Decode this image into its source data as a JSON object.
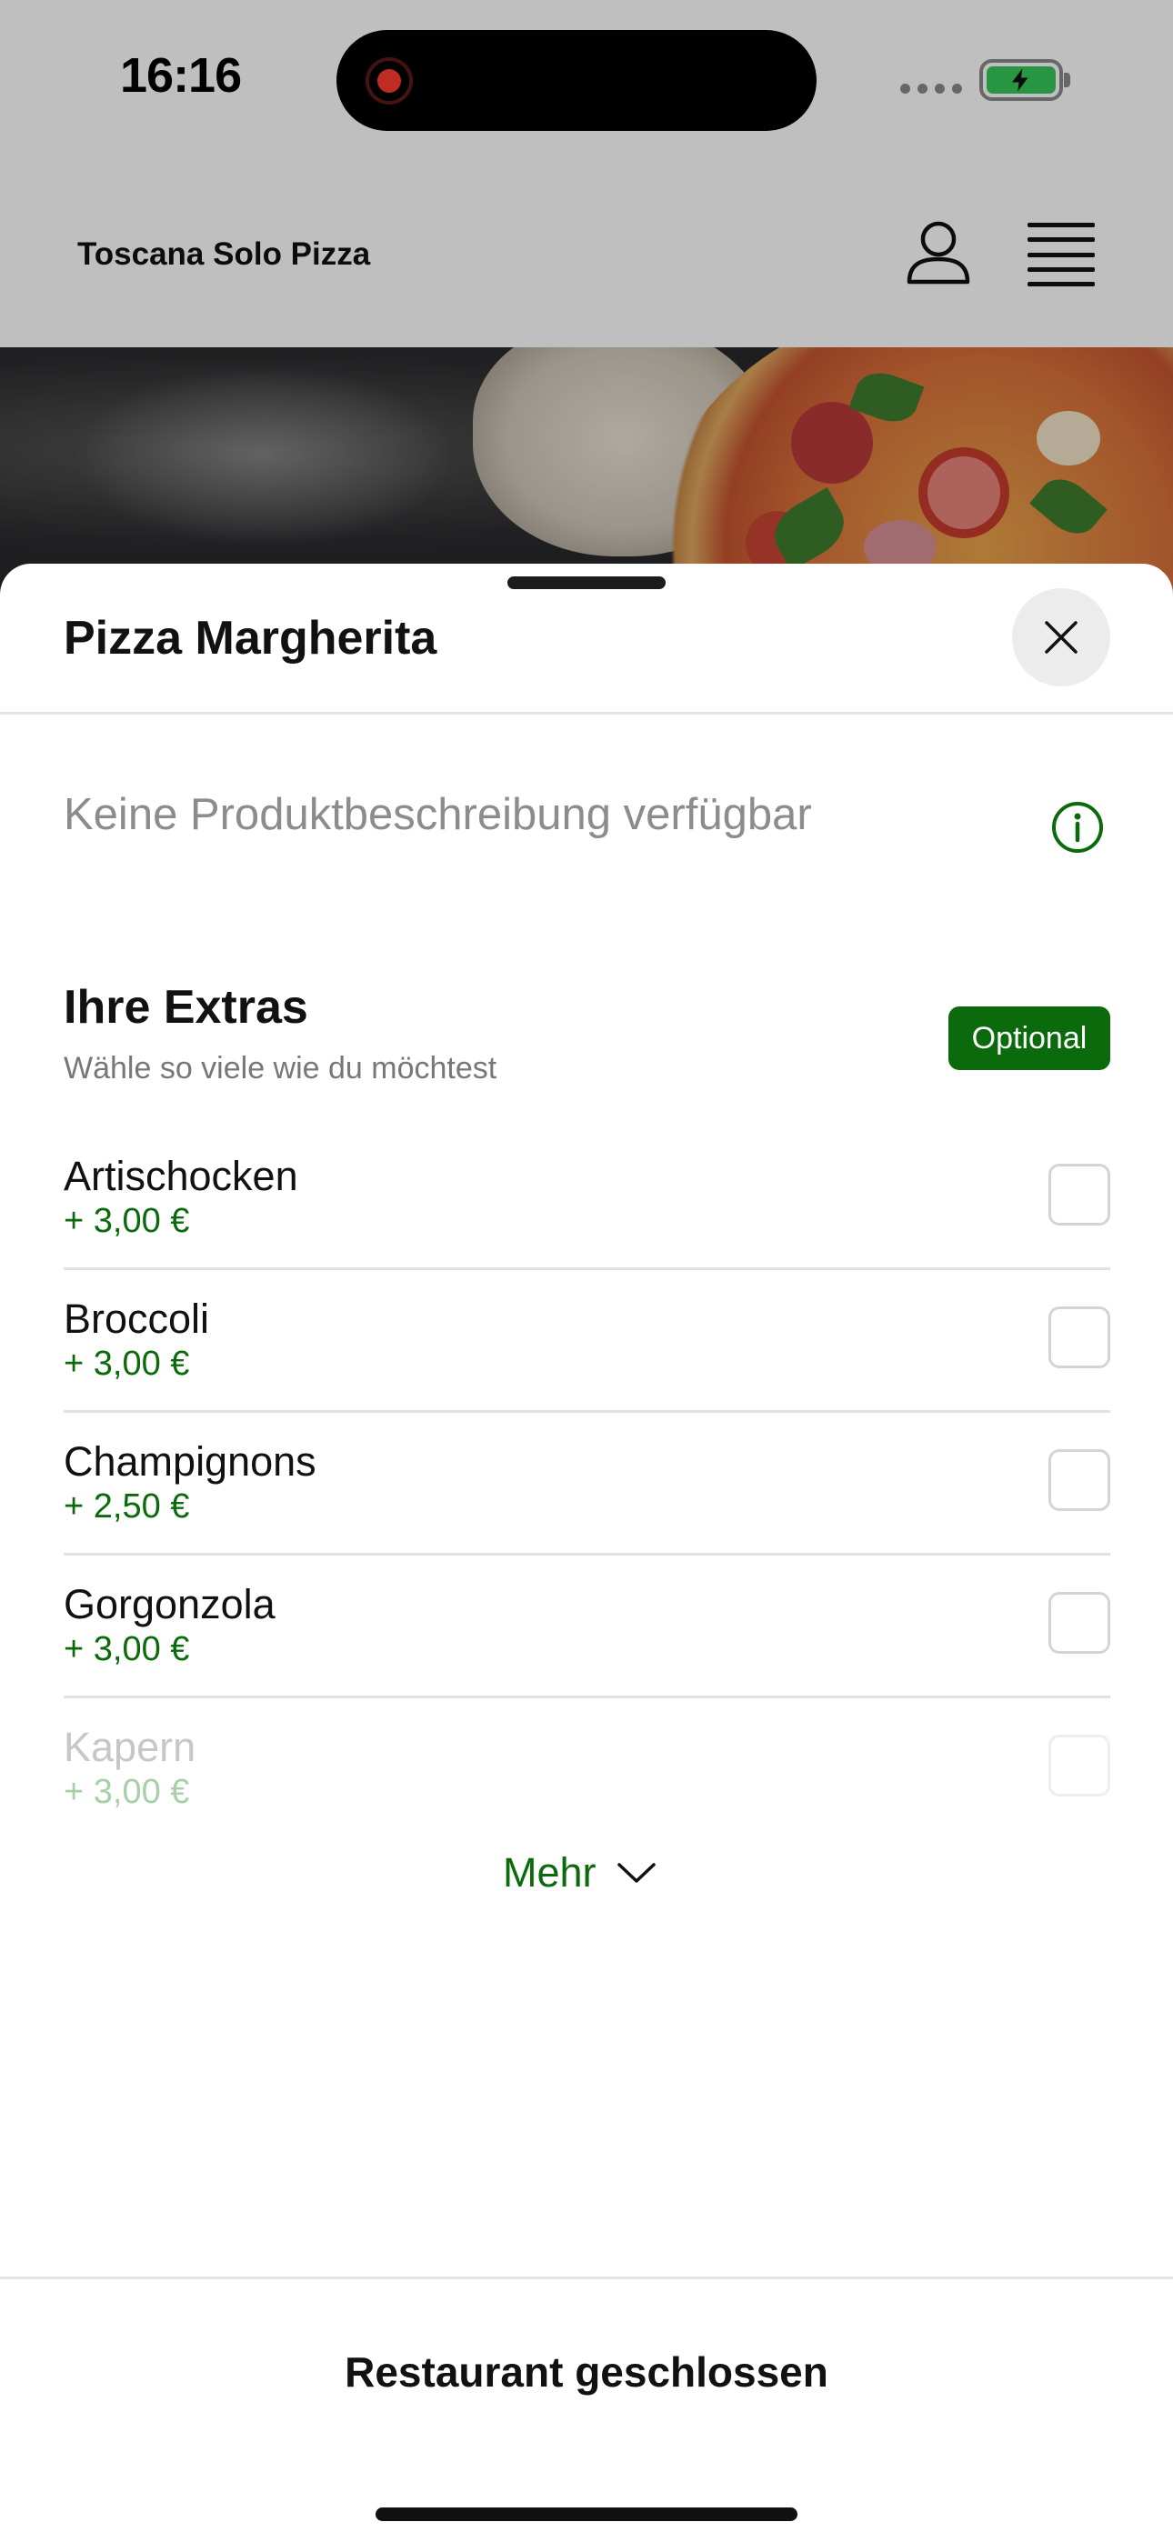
{
  "status_bar": {
    "time": "16:16"
  },
  "header": {
    "restaurant_name": "Toscana Solo Pizza",
    "account_icon": "person-icon",
    "menu_icon": "hamburger-menu-icon"
  },
  "sheet": {
    "title": "Pizza Margherita",
    "close_icon": "close-icon",
    "description": "Keine Produktbeschreibung verfügbar",
    "info_icon": "info-icon",
    "extras": {
      "title": "Ihre Extras",
      "subtitle": "Wähle so viele wie du möchtest",
      "badge": "Optional",
      "items": [
        {
          "name": "Artischocken",
          "price": "+ 3,00 €",
          "checked": false
        },
        {
          "name": "Broccoli",
          "price": "+ 3,00 €",
          "checked": false
        },
        {
          "name": "Champignons",
          "price": "+ 2,50 €",
          "checked": false
        },
        {
          "name": "Gorgonzola",
          "price": "+ 3,00 €",
          "checked": false
        },
        {
          "name": "Kapern",
          "price": "+ 3,00 €",
          "checked": false
        }
      ]
    },
    "more_label": "Mehr",
    "more_icon": "chevron-down-icon",
    "footer_label": "Restaurant geschlossen"
  },
  "colors": {
    "accent_green": "#0b6a0b",
    "overlay": "rgba(0,0,0,0.25)"
  }
}
